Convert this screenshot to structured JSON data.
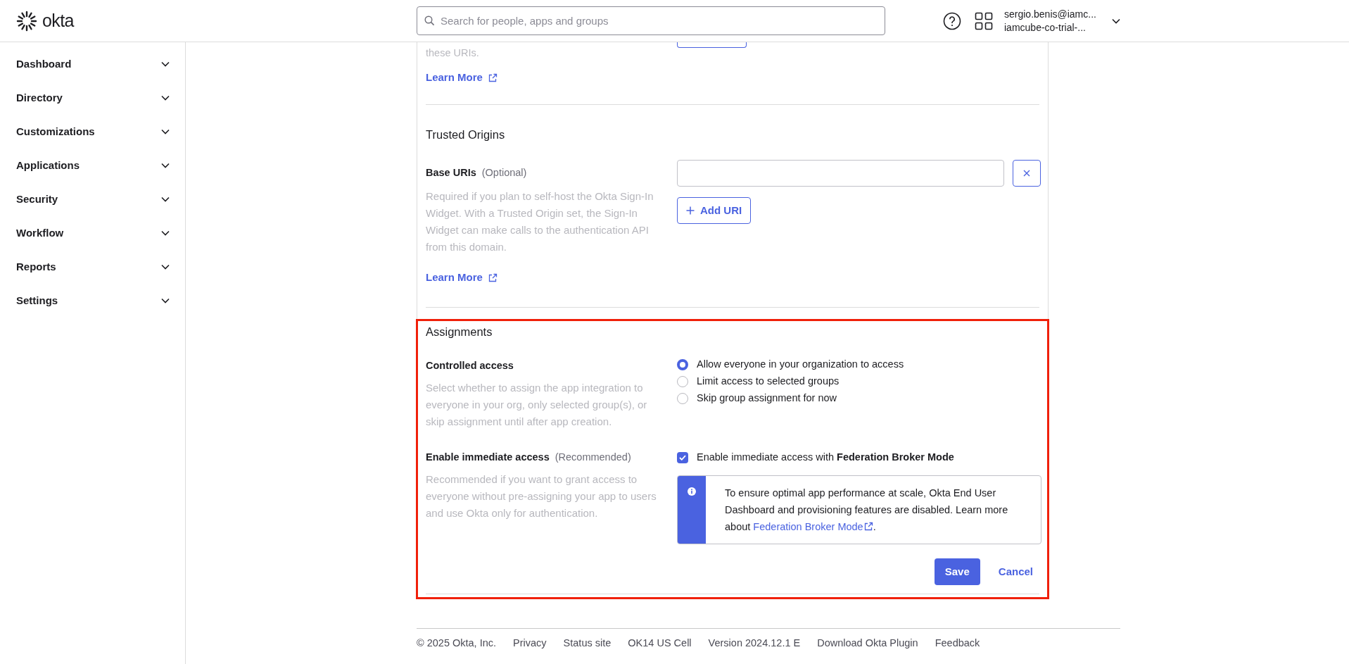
{
  "header": {
    "logo_text": "okta",
    "search": {
      "placeholder": "Search for people, apps and groups"
    },
    "user": {
      "email": "sergio.benis@iamc...",
      "org": "iamcube-co-trial-..."
    }
  },
  "sidebar": {
    "items": [
      {
        "label": "Dashboard",
        "expanded": false
      },
      {
        "label": "Directory",
        "expanded": false
      },
      {
        "label": "Customizations",
        "expanded": false
      },
      {
        "label": "Applications",
        "expanded": false
      },
      {
        "label": "Security",
        "expanded": false
      },
      {
        "label": "Workflow",
        "expanded": false
      },
      {
        "label": "Reports",
        "expanded": false
      },
      {
        "label": "Settings",
        "expanded": false
      }
    ]
  },
  "form": {
    "previous_section": {
      "description_tail": "these URIs.",
      "learn_more": "Learn More"
    },
    "trusted_origins": {
      "title": "Trusted Origins",
      "field_label": "Base URIs",
      "field_hint": "(Optional)",
      "description": "Required if you plan to self-host the Okta Sign-In Widget. With a Trusted Origin set, the Sign-In Widget can make calls to the authentication API from this domain.",
      "add_button": "Add URI",
      "learn_more": "Learn More"
    },
    "assignments": {
      "title": "Assignments",
      "highlighted": true,
      "controlled_access": {
        "label": "Controlled access",
        "description": "Select whether to assign the app integration to everyone in your org, only selected group(s), or skip assignment until after app creation.",
        "options": [
          {
            "label": "Allow everyone in your organization to access",
            "selected": true
          },
          {
            "label": "Limit access to selected groups",
            "selected": false
          },
          {
            "label": "Skip group assignment for now",
            "selected": false
          }
        ]
      },
      "immediate_access": {
        "label": "Enable immediate access",
        "hint": "(Recommended)",
        "description": "Recommended if you want to grant access to everyone without pre-assigning your app to users and use Okta only for authentication.",
        "checkbox": {
          "label": "Enable immediate access with **Federation Broker Mode**",
          "checked": true
        },
        "info": {
          "text": "To ensure optimal app performance at scale, Okta End User Dashboard and provisioning features are disabled. Learn more about ",
          "link": "Federation Broker Mode",
          "tail": "."
        }
      },
      "save": "Save",
      "cancel": "Cancel"
    }
  },
  "footer": {
    "items": [
      "© 2025 Okta, Inc.",
      "Privacy",
      "Status site",
      "OK14 US Cell",
      "Version 2024.12.1 E",
      "Download Okta Plugin",
      "Feedback"
    ]
  }
}
